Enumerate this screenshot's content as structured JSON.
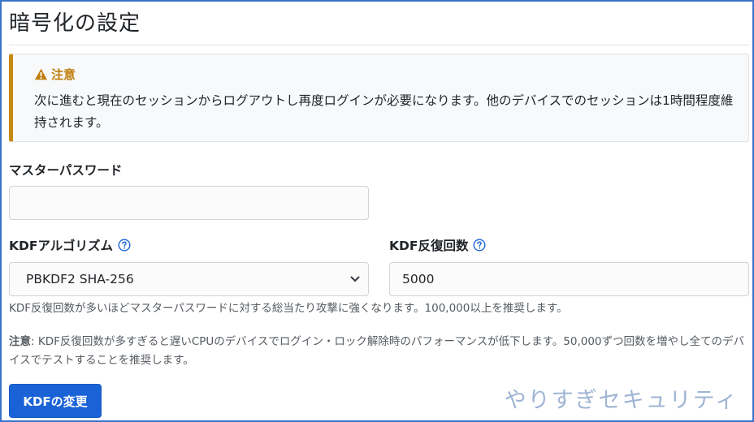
{
  "page": {
    "title": "暗号化の設定"
  },
  "callout": {
    "heading": "注意",
    "body": "次に進むと現在のセッションからログアウトし再度ログインが必要になります。他のデバイスでのセッションは1時間程度維持されます。",
    "accent_color": "#c48a10",
    "icon": "warning-triangle-icon"
  },
  "master_password": {
    "label": "マスターパスワード",
    "value": ""
  },
  "kdf_algorithm": {
    "label": "KDFアルゴリズム",
    "selected": "PBKDF2 SHA-256",
    "help_icon": "question-circle-icon"
  },
  "kdf_iterations": {
    "label": "KDF反復回数",
    "value": "5000",
    "help_icon": "question-circle-icon"
  },
  "help": {
    "iterations_hint": "KDF反復回数が多いほどマスターパスワードに対する総当たり攻撃に強くなります。100,000以上を推奨します。",
    "note_label": "注意",
    "note_text": ": KDF反復回数が多すぎると遅いCPUのデバイスでログイン・ロック解除時のパフォーマンスが低下します。50,000ずつ回数を増やし全てのデバイスでテストすることを推奨します。"
  },
  "actions": {
    "change_kdf_label": "KDFの変更",
    "primary_color": "#1a63d6"
  },
  "watermark": {
    "text": "やりすぎセキュリティ"
  }
}
